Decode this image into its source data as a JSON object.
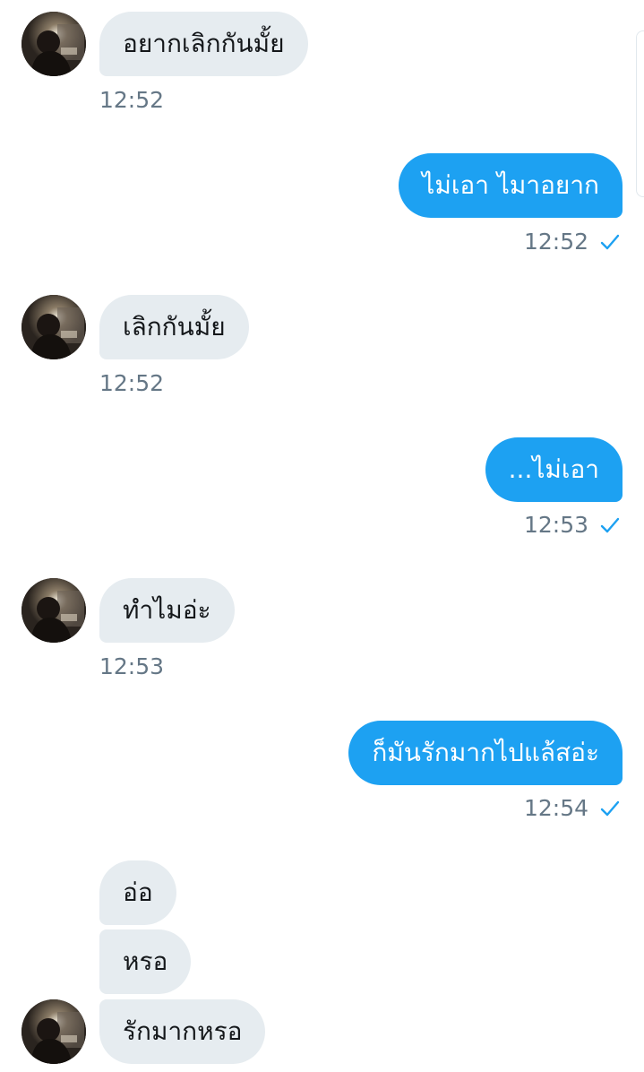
{
  "conversation": {
    "messages": [
      {
        "direction": "in",
        "text": "อยากเลิกกันมั้ย",
        "time": "12:52"
      },
      {
        "direction": "out",
        "text": "ไม่เอา ไมาอยาก",
        "time": "12:52",
        "status_icon": "check-icon"
      },
      {
        "direction": "in",
        "text": "เลิกกันมั้ย",
        "time": "12:52"
      },
      {
        "direction": "out",
        "text": "...ไม่เอา",
        "time": "12:53",
        "status_icon": "check-icon"
      },
      {
        "direction": "in",
        "text": "ทำไมอ่ะ",
        "time": "12:53"
      },
      {
        "direction": "out",
        "text": "ก็มันรักมากไปแล้สอ่ะ",
        "time": "12:54",
        "status_icon": "check-icon"
      },
      {
        "direction": "in",
        "text": "อ่อ"
      },
      {
        "direction": "in",
        "text": "หรอ"
      },
      {
        "direction": "in",
        "text": "รักมากหรอ"
      }
    ]
  },
  "colors": {
    "outgoing_bubble": "#1da1f2",
    "incoming_bubble": "#e6ecf0",
    "timestamp": "#657786",
    "read_check": "#1da1f2"
  }
}
